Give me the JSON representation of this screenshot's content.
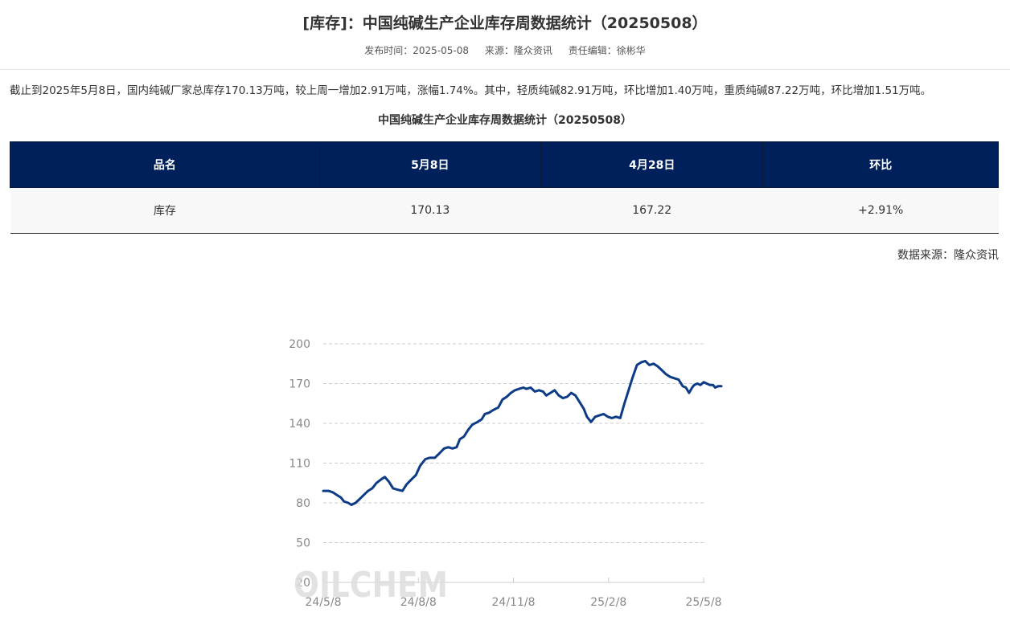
{
  "page": {
    "title": "[库存]：中国纯碱生产企业库存周数据统计（20250508）",
    "publish_time": "发布时间：2025-05-08",
    "source_label": "来源：隆众资讯",
    "editor": "责任编辑：徐彬华",
    "summary": "截止到2025年5月8日，国内纯碱厂家总库存170.13万吨，较上周一增加2.91万吨，涨幅1.74%。其中，轻质纯碱82.91万吨，环比增加1.40万吨，重质纯碱87.22万吨，环比增加1.51万吨。"
  },
  "table": {
    "title": "中国纯碱生产企业库存周数据统计（20250508）",
    "headers": [
      "品名",
      "5月8日",
      "4月28日",
      "环比"
    ],
    "rows": [
      [
        "库存",
        "170.13",
        "167.22",
        "+2.91%"
      ]
    ],
    "data_source": "数据来源：隆众资讯"
  },
  "chart_data": {
    "type": "line",
    "watermark": "OILCHEM",
    "color": "#0d3b85",
    "ylim": [
      20,
      200
    ],
    "yticks": [
      200,
      170,
      140,
      110,
      80,
      50,
      20
    ],
    "xticks": [
      "24/5/8",
      "24/8/8",
      "24/11/8",
      "25/2/8",
      "25/5/8"
    ],
    "x_range": [
      "2024-05-08",
      "2025-05-08"
    ],
    "grid": "horizontal-dashed",
    "series": [
      {
        "name": "",
        "points": [
          [
            "2024-05-08",
            89
          ],
          [
            "2024-05-13",
            89
          ],
          [
            "2024-05-17",
            88
          ],
          [
            "2024-05-21",
            86
          ],
          [
            "2024-05-25",
            84
          ],
          [
            "2024-05-28",
            81
          ],
          [
            "2024-06-01",
            80
          ],
          [
            "2024-06-04",
            78.5
          ],
          [
            "2024-06-08",
            80
          ],
          [
            "2024-06-12",
            83
          ],
          [
            "2024-06-16",
            86
          ],
          [
            "2024-06-20",
            89
          ],
          [
            "2024-06-24",
            91
          ],
          [
            "2024-06-28",
            95
          ],
          [
            "2024-07-03",
            98
          ],
          [
            "2024-07-06",
            99.5
          ],
          [
            "2024-07-10",
            96
          ],
          [
            "2024-07-14",
            91
          ],
          [
            "2024-07-18",
            90
          ],
          [
            "2024-07-23",
            89
          ],
          [
            "2024-07-27",
            94
          ],
          [
            "2024-08-01",
            98
          ],
          [
            "2024-08-05",
            101
          ],
          [
            "2024-08-09",
            108
          ],
          [
            "2024-08-14",
            113
          ],
          [
            "2024-08-18",
            114
          ],
          [
            "2024-08-23",
            114
          ],
          [
            "2024-08-27",
            117
          ],
          [
            "2024-09-01",
            121
          ],
          [
            "2024-09-05",
            122
          ],
          [
            "2024-09-09",
            121
          ],
          [
            "2024-09-13",
            122
          ],
          [
            "2024-09-16",
            128
          ],
          [
            "2024-09-20",
            130
          ],
          [
            "2024-09-24",
            135
          ],
          [
            "2024-09-28",
            139
          ],
          [
            "2024-10-03",
            141
          ],
          [
            "2024-10-07",
            143
          ],
          [
            "2024-10-10",
            147
          ],
          [
            "2024-10-14",
            148
          ],
          [
            "2024-10-18",
            150
          ],
          [
            "2024-10-23",
            152
          ],
          [
            "2024-10-27",
            158
          ],
          [
            "2024-10-31",
            160
          ],
          [
            "2024-11-04",
            163
          ],
          [
            "2024-11-08",
            165
          ],
          [
            "2024-11-12",
            166
          ],
          [
            "2024-11-16",
            167
          ],
          [
            "2024-11-19",
            166
          ],
          [
            "2024-11-23",
            167
          ],
          [
            "2024-11-27",
            164
          ],
          [
            "2024-12-01",
            165
          ],
          [
            "2024-12-05",
            164
          ],
          [
            "2024-12-08",
            161
          ],
          [
            "2024-12-12",
            163
          ],
          [
            "2024-12-16",
            165
          ],
          [
            "2024-12-20",
            161
          ],
          [
            "2024-12-24",
            159
          ],
          [
            "2024-12-28",
            160
          ],
          [
            "2025-01-01",
            163
          ],
          [
            "2025-01-05",
            161
          ],
          [
            "2025-01-09",
            156
          ],
          [
            "2025-01-13",
            151
          ],
          [
            "2025-01-16",
            145
          ],
          [
            "2025-01-20",
            141
          ],
          [
            "2025-01-24",
            145
          ],
          [
            "2025-01-28",
            146
          ],
          [
            "2025-02-01",
            147
          ],
          [
            "2025-02-05",
            145
          ],
          [
            "2025-02-09",
            144
          ],
          [
            "2025-02-13",
            145
          ],
          [
            "2025-02-17",
            144
          ],
          [
            "2025-02-21",
            155
          ],
          [
            "2025-02-25",
            165
          ],
          [
            "2025-03-01",
            175
          ],
          [
            "2025-03-05",
            184
          ],
          [
            "2025-03-09",
            186
          ],
          [
            "2025-03-13",
            187
          ],
          [
            "2025-03-17",
            184
          ],
          [
            "2025-03-21",
            185
          ],
          [
            "2025-03-25",
            183
          ],
          [
            "2025-03-29",
            180
          ],
          [
            "2025-04-02",
            177
          ],
          [
            "2025-04-06",
            175
          ],
          [
            "2025-04-10",
            174
          ],
          [
            "2025-04-14",
            173
          ],
          [
            "2025-04-18",
            168
          ],
          [
            "2025-04-21",
            167
          ],
          [
            "2025-04-24",
            163
          ],
          [
            "2025-04-27",
            167
          ],
          [
            "2025-04-29",
            169
          ],
          [
            "2025-05-02",
            170
          ],
          [
            "2025-05-05",
            169
          ],
          [
            "2025-05-08",
            171
          ],
          [
            "2025-05-11",
            170
          ],
          [
            "2025-05-14",
            169
          ],
          [
            "2025-05-17",
            169
          ],
          [
            "2025-05-19",
            167
          ],
          [
            "2025-05-22",
            168
          ],
          [
            "2025-05-25",
            168
          ]
        ]
      }
    ]
  }
}
